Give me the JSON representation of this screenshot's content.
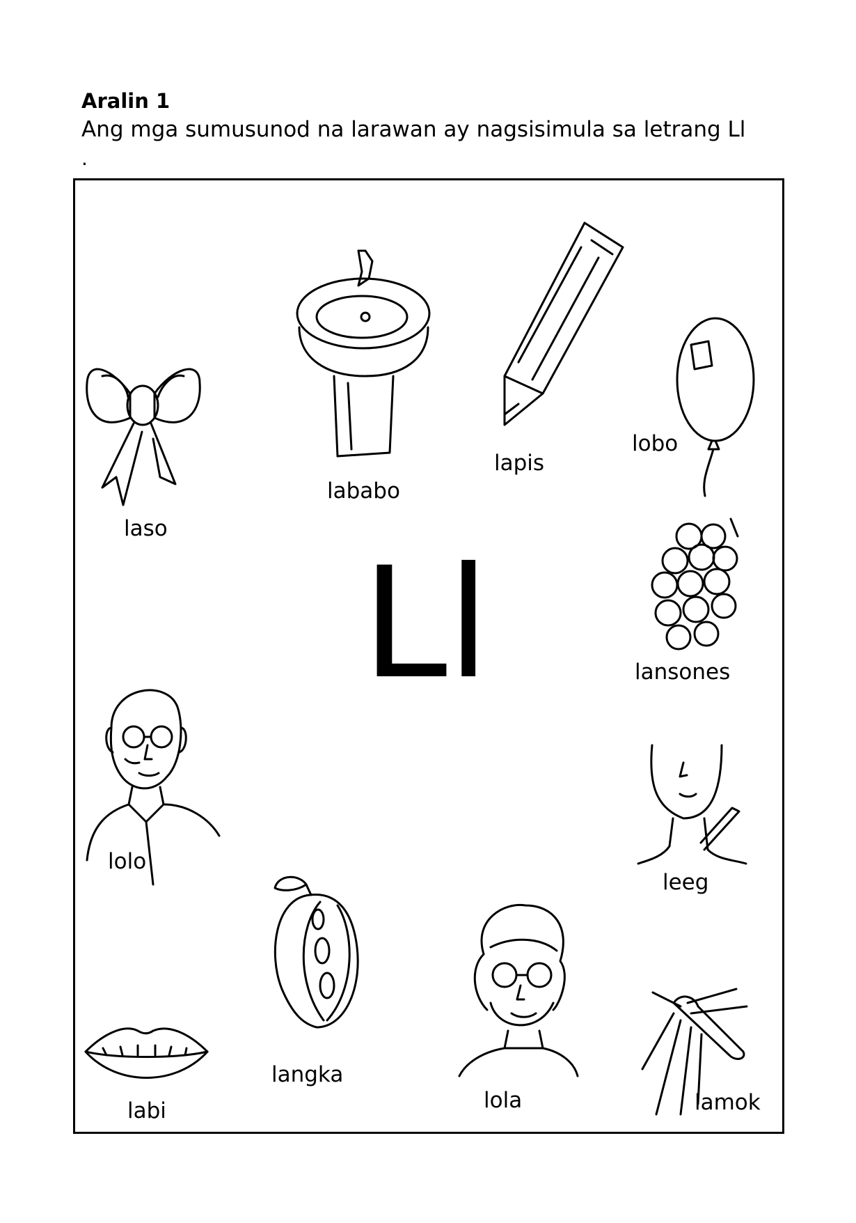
{
  "heading": "Aralin 1",
  "instruction": "Ang mga  sumusunod na larawan ay nagsisimula sa letrang Ll",
  "instruction_dot": ".",
  "big_letter": "Ll",
  "items": [
    {
      "label": "laso",
      "icon": "ribbon-bow-icon"
    },
    {
      "label": "lababo",
      "icon": "sink-icon"
    },
    {
      "label": "lapis",
      "icon": "pencil-icon"
    },
    {
      "label": "lobo",
      "icon": "balloon-icon"
    },
    {
      "label": "lansones",
      "icon": "lanzones-icon"
    },
    {
      "label": "leeg",
      "icon": "neck-icon"
    },
    {
      "label": "lamok",
      "icon": "mosquito-icon"
    },
    {
      "label": "lola",
      "icon": "grandmother-icon"
    },
    {
      "label": "langka",
      "icon": "jackfruit-icon"
    },
    {
      "label": "labi",
      "icon": "lips-icon"
    },
    {
      "label": "lolo",
      "icon": "grandfather-icon"
    }
  ]
}
